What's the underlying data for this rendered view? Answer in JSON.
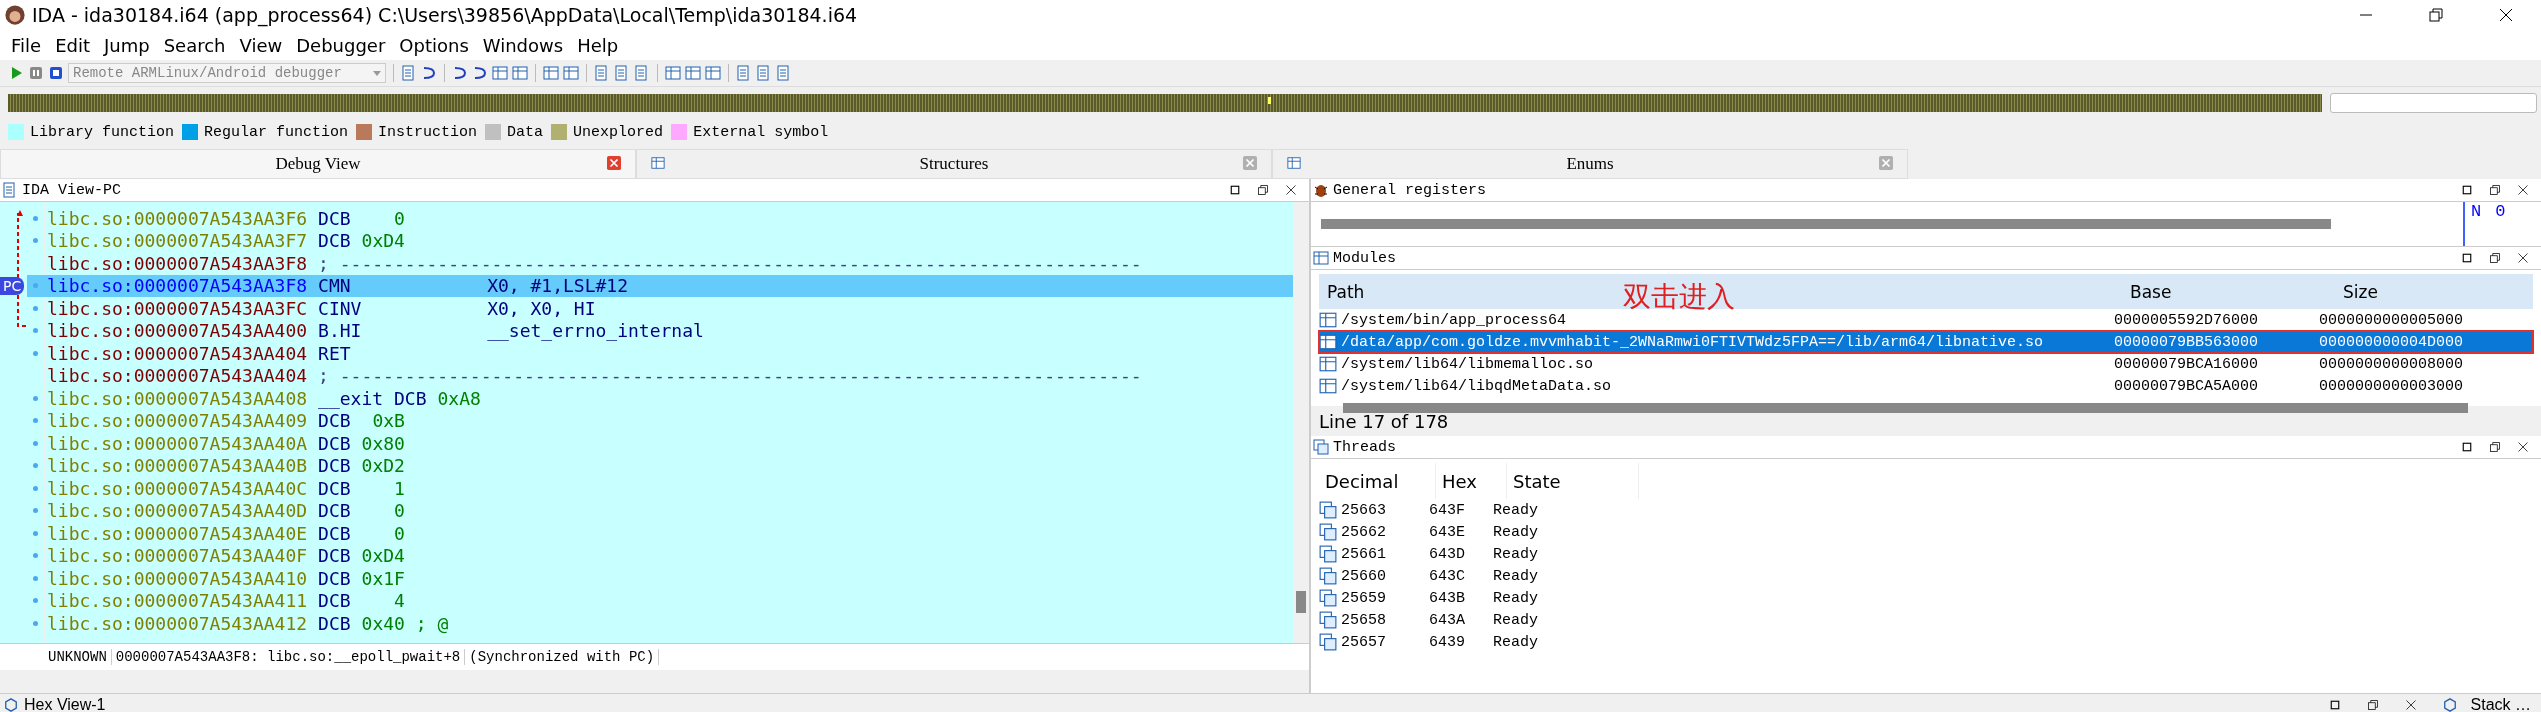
{
  "window": {
    "title": "IDA - ida30184.i64 (app_process64) C:\\Users\\39856\\AppData\\Local\\Temp\\ida30184.i64"
  },
  "menu": [
    "File",
    "Edit",
    "Jump",
    "Search",
    "View",
    "Debugger",
    "Options",
    "Windows",
    "Help"
  ],
  "toolbar": {
    "debugger_select": {
      "value": "Remote ARMLinux/Android debugger",
      "disabled": true
    }
  },
  "legend": [
    {
      "label": "Library function",
      "color": "#aaffff"
    },
    {
      "label": "Regular function",
      "color": "#00a0e8"
    },
    {
      "label": "Instruction",
      "color": "#b87a5a"
    },
    {
      "label": "Data",
      "color": "#c0c0c0"
    },
    {
      "label": "Unexplored",
      "color": "#b0b070"
    },
    {
      "label": "External symbol",
      "color": "#ffa8ff"
    }
  ],
  "tabs": [
    {
      "label": "Debug View",
      "selected": true
    },
    {
      "label": "Structures",
      "selected": false
    },
    {
      "label": "Enums",
      "selected": false
    }
  ],
  "ida_view": {
    "title": "IDA View-PC",
    "pc_marker": "PC",
    "lines": [
      {
        "kind": "data",
        "addr": "libc.so:0000007A543AA3F6",
        "mnemonic": "DCB",
        "operand": "0",
        "selected": false
      },
      {
        "kind": "data",
        "addr": "libc.so:0000007A543AA3F7",
        "mnemonic": "DCB",
        "operand": "0xD4",
        "selected": false
      },
      {
        "kind": "sep",
        "addr": "libc.so:0000007A543AA3F8",
        "operand": "; --------------------------------------------------------------------------",
        "selected": false
      },
      {
        "kind": "code",
        "addr": "libc.so:0000007A543AA3F8",
        "mnemonic": "CMN",
        "operand": "X0, #1,LSL#12",
        "selected": true
      },
      {
        "kind": "code",
        "addr": "libc.so:0000007A543AA3FC",
        "mnemonic": "CINV",
        "operand": "X0, X0, HI",
        "selected": false
      },
      {
        "kind": "code",
        "addr": "libc.so:0000007A543AA400",
        "mnemonic": "B.HI",
        "operand": "__set_errno_internal",
        "selected": false
      },
      {
        "kind": "code",
        "addr": "libc.so:0000007A543AA404",
        "mnemonic": "RET",
        "selected": false
      },
      {
        "kind": "sep",
        "addr": "libc.so:0000007A543AA404",
        "operand": "; --------------------------------------------------------------------------",
        "selected": false
      },
      {
        "kind": "data",
        "addr": "libc.so:0000007A543AA408",
        "mnemonic": "__exit DCB",
        "operand": "0xA8",
        "selected": false
      },
      {
        "kind": "data",
        "addr": "libc.so:0000007A543AA409",
        "mnemonic": "DCB",
        "operand": "0xB",
        "selected": false
      },
      {
        "kind": "data",
        "addr": "libc.so:0000007A543AA40A",
        "mnemonic": "DCB",
        "operand": "0x80",
        "selected": false
      },
      {
        "kind": "data",
        "addr": "libc.so:0000007A543AA40B",
        "mnemonic": "DCB",
        "operand": "0xD2",
        "selected": false
      },
      {
        "kind": "data",
        "addr": "libc.so:0000007A543AA40C",
        "mnemonic": "DCB",
        "operand": "1",
        "selected": false
      },
      {
        "kind": "data",
        "addr": "libc.so:0000007A543AA40D",
        "mnemonic": "DCB",
        "operand": "0",
        "selected": false
      },
      {
        "kind": "data",
        "addr": "libc.so:0000007A543AA40E",
        "mnemonic": "DCB",
        "operand": "0",
        "selected": false
      },
      {
        "kind": "data",
        "addr": "libc.so:0000007A543AA40F",
        "mnemonic": "DCB",
        "operand": "0xD4",
        "selected": false
      },
      {
        "kind": "data",
        "addr": "libc.so:0000007A543AA410",
        "mnemonic": "DCB",
        "operand": "0x1F",
        "selected": false
      },
      {
        "kind": "data",
        "addr": "libc.so:0000007A543AA411",
        "mnemonic": "DCB",
        "operand": "4",
        "selected": false
      },
      {
        "kind": "data",
        "addr": "libc.so:0000007A543AA412",
        "mnemonic": "DCB",
        "operand": "0x40 ; @",
        "selected": false
      }
    ],
    "status": [
      "UNKNOWN",
      "0000007A543AA3F8: libc.so:__epoll_pwait+8",
      "(Synchronized with PC)"
    ]
  },
  "registers": {
    "title": "General registers",
    "flags": [
      {
        "name": "N",
        "value": "0"
      }
    ]
  },
  "modules": {
    "title": "Modules",
    "columns": [
      "Path",
      "Base",
      "Size"
    ],
    "annotation": "双击进入",
    "rows": [
      {
        "path": "/system/bin/app_process64",
        "base": "0000005592D76000",
        "size": "0000000000005000",
        "selected": false,
        "highlighted": false
      },
      {
        "path": "/data/app/com.goldze.mvvmhabit-_2WNaRmwi0FTIVTWdz5FPA==/lib/arm64/libnative.so",
        "base": "00000079BB563000",
        "size": "000000000004D000",
        "selected": true,
        "highlighted": true
      },
      {
        "path": "/system/lib64/libmemalloc.so",
        "base": "00000079BCA16000",
        "size": "0000000000008000",
        "selected": false,
        "highlighted": false
      },
      {
        "path": "/system/lib64/libqdMetaData.so",
        "base": "00000079BCA5A000",
        "size": "0000000000003000",
        "selected": false,
        "highlighted": false
      }
    ],
    "status": "Line 17 of 178"
  },
  "threads": {
    "title": "Threads",
    "columns": [
      "Decimal",
      "Hex",
      "State"
    ],
    "rows": [
      {
        "decimal": "25663",
        "hex": "643F",
        "state": "Ready"
      },
      {
        "decimal": "25662",
        "hex": "643E",
        "state": "Ready"
      },
      {
        "decimal": "25661",
        "hex": "643D",
        "state": "Ready"
      },
      {
        "decimal": "25660",
        "hex": "643C",
        "state": "Ready"
      },
      {
        "decimal": "25659",
        "hex": "643B",
        "state": "Ready"
      },
      {
        "decimal": "25658",
        "hex": "643A",
        "state": "Ready"
      },
      {
        "decimal": "25657",
        "hex": "6439",
        "state": "Ready"
      }
    ]
  },
  "bottom": {
    "left": "Hex View-1",
    "right": "Stack …"
  }
}
